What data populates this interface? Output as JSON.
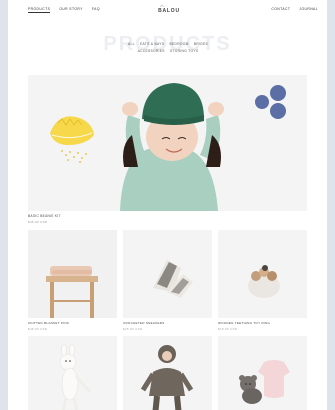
{
  "nav": {
    "left": [
      "PRODUCTS",
      "OUR STORY",
      "FAQ"
    ],
    "right": [
      "CONTACT",
      "JOURNAL"
    ]
  },
  "logo": {
    "text": "BALOU"
  },
  "page": {
    "title": "PRODUCTS"
  },
  "categories": {
    "row1": [
      "ALL",
      "EATS & BAYS",
      "BEDROOM",
      "BRIDES"
    ],
    "row2": [
      "ACCESSORIES",
      "STORING TOYS"
    ]
  },
  "hero": {
    "title": "BASIC BEANIE KIT",
    "subtitle": "$45.00 USD"
  },
  "products": [
    {
      "name": "KNITTED BLANKET PINK",
      "price": "$45.00 USD"
    },
    {
      "name": "CROCHETED SNEAKERS",
      "price": "$25.00 USD"
    },
    {
      "name": "WOODEN TEETHING TOY RING",
      "price": "$18.00 USD"
    }
  ],
  "colors": {
    "background": "#dfe4ec",
    "lemon": "#f6d84a",
    "berries": "#5b6ea6",
    "beanie": "#2f6e55",
    "sweater": "#a8cfc0"
  }
}
